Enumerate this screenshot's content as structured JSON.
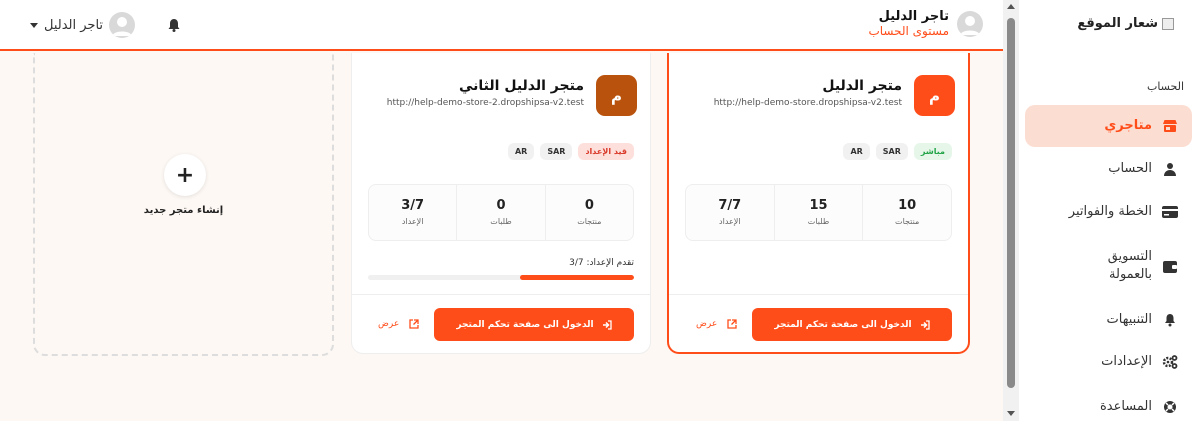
{
  "topbar": {
    "profile_name": "تاجر الدليل",
    "profile_level": "مستوى الحساب",
    "user_name": "تاجر الدليل"
  },
  "stores": [
    {
      "initial": "م",
      "name": "متجر الدليل",
      "url": "http://help-demo-store.dropshipsa-v2.test",
      "badges": [
        "مباشر",
        "SAR",
        "AR"
      ],
      "stats": [
        {
          "value": "10",
          "label": "منتجات"
        },
        {
          "value": "15",
          "label": "طلبات"
        },
        {
          "value": "7/7",
          "label": "الإعداد"
        }
      ],
      "enter_label": "الدخول الى صفحة تحكم المتجر",
      "view_label": "عرض",
      "icon_color": "#ff4d1a"
    },
    {
      "initial": "م",
      "name": "متجر الدليل الثاني",
      "url": "http://help-demo-store-2.dropshipsa-v2.test",
      "badges": [
        "قيد الإعداد",
        "SAR",
        "AR"
      ],
      "stats": [
        {
          "value": "0",
          "label": "منتجات"
        },
        {
          "value": "0",
          "label": "طلبات"
        },
        {
          "value": "3/7",
          "label": "الإعداد"
        }
      ],
      "progress_label": "تقدم الإعداد: 3/7",
      "progress_fraction": 0.43,
      "enter_label": "الدخول الى صفحة تحكم المتجر",
      "view_label": "عرض",
      "icon_color": "#b8520c"
    }
  ],
  "new_store": {
    "plus": "+",
    "label": "إنشاء متجر جديد"
  },
  "sidebar": {
    "logo_text": "شعار الموقع",
    "section_heading": "الحساب",
    "items": [
      {
        "label": "متاجري",
        "icon": "store-icon"
      },
      {
        "label": "الحساب",
        "icon": "user-icon"
      },
      {
        "label": "الخطة والفواتير",
        "icon": "card-icon"
      },
      {
        "label": "التسويق\nبالعمولة",
        "icon": "wallet-icon"
      },
      {
        "label": "التنبيهات",
        "icon": "bell-icon"
      },
      {
        "label": "الإعدادات",
        "icon": "gears-icon"
      },
      {
        "label": "المساعدة",
        "icon": "lifebuoy-icon"
      }
    ]
  },
  "colors": {
    "accent": "#ff4d1a",
    "active_bg": "#fcddd2",
    "live": "#22a447",
    "setup": "#d93a2b"
  }
}
